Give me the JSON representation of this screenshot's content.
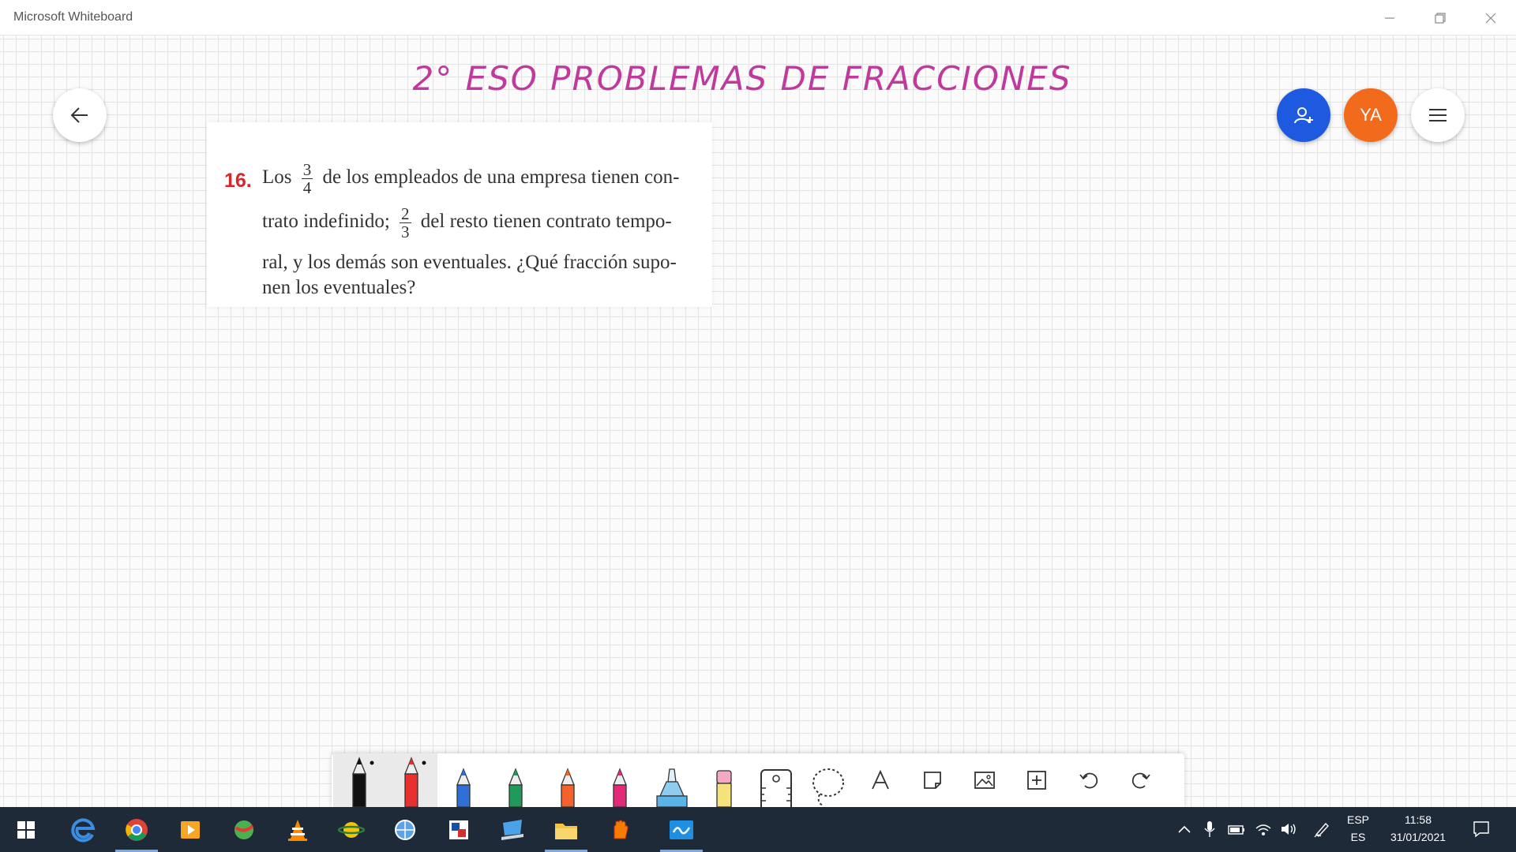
{
  "window": {
    "title": "Microsoft Whiteboard"
  },
  "canvas": {
    "title": "2° ESO PROBLEMAS DE FRACCIONES",
    "avatar_initials": "YA",
    "problem": {
      "number": "16.",
      "line1_a": "Los",
      "frac1_num": "3",
      "frac1_den": "4",
      "line1_b": "de los empleados de una empresa tienen con-",
      "line2_a": "trato indefinido;",
      "frac2_num": "2",
      "frac2_den": "3",
      "line2_b": "del resto tienen contrato tempo-",
      "line3": "ral, y los demás son eventuales. ¿Qué fracción supo-",
      "line4": "nen los eventuales?"
    }
  },
  "toolbar": {
    "tools": [
      {
        "name": "pen-black",
        "color": "#111111"
      },
      {
        "name": "pen-red",
        "color": "#e8302e"
      },
      {
        "name": "pen-blue",
        "color": "#2f6fd6"
      },
      {
        "name": "pen-green",
        "color": "#1f9a5a"
      },
      {
        "name": "pen-orange",
        "color": "#f2622a"
      },
      {
        "name": "pen-pink",
        "color": "#e32a78"
      },
      {
        "name": "highlighter",
        "color": "#5ab4e8"
      },
      {
        "name": "eraser",
        "color": "#f4a8c4"
      }
    ]
  },
  "tray": {
    "language_top": "ESP",
    "language_bottom": "ES",
    "time": "11:58",
    "date": "31/01/2021"
  }
}
